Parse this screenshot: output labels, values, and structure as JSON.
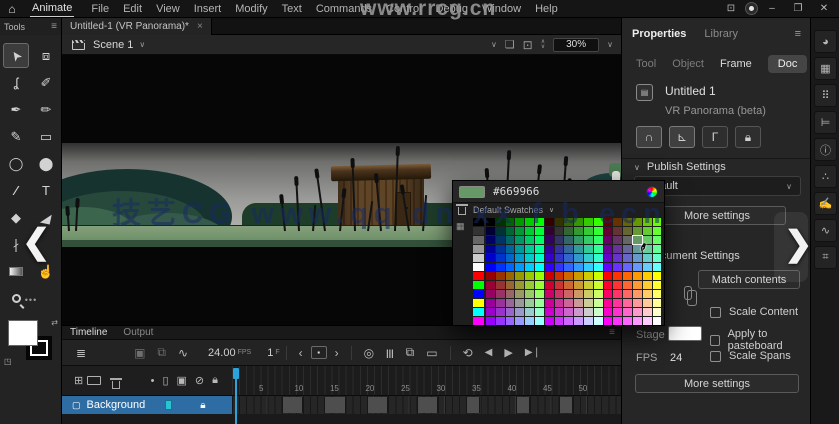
{
  "menubar": {
    "home_icon": "⌂",
    "app_label": "Animate",
    "items": [
      "File",
      "Edit",
      "View",
      "Insert",
      "Modify",
      "Text",
      "Commands",
      "Control",
      "Debug",
      "Window",
      "Help"
    ],
    "watermark": "www.rrcg.cn",
    "workspace_icon": "⊡",
    "minimize_icon": "–",
    "restore_icon": "❐",
    "close_icon": "✕"
  },
  "document_tab": {
    "title": "Untitled-1 (VR Panorama)*",
    "close_icon": "×"
  },
  "tools_panel": {
    "title": "Tools",
    "menu_icon": "≡",
    "more_icon": "•••",
    "tools": [
      {
        "name": "selection-tool",
        "glyph": "➤",
        "selected": true
      },
      {
        "name": "free-transform-tool",
        "glyph": "⧈"
      },
      {
        "name": "lasso-tool",
        "glyph": "ʆ"
      },
      {
        "name": "fluid-brush-tool",
        "glyph": "✐"
      },
      {
        "name": "classic-brush-tool",
        "glyph": "✒"
      },
      {
        "name": "pencil-tool",
        "glyph": "✏"
      },
      {
        "name": "pen-tool",
        "glyph": "✎"
      },
      {
        "name": "rectangle-tool",
        "glyph": "▭"
      },
      {
        "name": "oval-tool",
        "glyph": "◯"
      },
      {
        "name": "primitive-oval-tool",
        "glyph": "⬤"
      },
      {
        "name": "line-tool",
        "glyph": "∕"
      },
      {
        "name": "text-tool",
        "glyph": "T"
      },
      {
        "name": "eraser-tool",
        "glyph": "◆"
      },
      {
        "name": "paint-bucket-tool",
        "glyph": "◢"
      },
      {
        "name": "eyedropper-tool",
        "glyph": "∤"
      },
      {
        "name": "",
        "glyph": ""
      },
      {
        "name": "gradient-swatch-tool",
        "glyph": "",
        "kind": "grad"
      },
      {
        "name": "hand-tool",
        "glyph": "☝"
      },
      {
        "name": "zoom-tool",
        "glyph": "",
        "kind": "mag"
      },
      {
        "name": "",
        "glyph": ""
      }
    ]
  },
  "stage_bar": {
    "scene_label": "Scene 1",
    "scene_chevron": "∨",
    "collapse_chevron": "∨",
    "clip_icon_name": "clip-content-icon",
    "center_icon": "⊡",
    "zoom_value": "30%",
    "zoom_chevron": "∨"
  },
  "canvas": {
    "watermark": "技艺CG   www.qq  dn  xx  f  b  ecn"
  },
  "color_picker": {
    "hex_value": "#669966",
    "selected": "#669966",
    "dropdown_label": "Default Swatches",
    "dropdown_chevron": "∨",
    "grid_icon": "▦",
    "strip": [
      "#000000",
      "#333333",
      "#666666",
      "#999999",
      "#CCCCCC",
      "#FFFFFF",
      "#FF0000",
      "#00FF00",
      "#0000FF",
      "#FFFF00",
      "#00FFFF",
      "#FF00FF"
    ],
    "grid_values": [
      "00",
      "33",
      "66",
      "99",
      "CC",
      "FF"
    ]
  },
  "properties_panel": {
    "tabs": [
      "Properties",
      "Library"
    ],
    "menu_icon": "≡",
    "subtabs": [
      "Tool",
      "Object",
      "Frame",
      "Doc"
    ],
    "active_subtab": "Doc",
    "doc_icon_glyph": "▤",
    "doc_name": "Untitled 1",
    "doc_type": "VR Panorama (beta)",
    "snap_buttons": [
      {
        "name": "snap-to-objects-button",
        "glyph": "∩",
        "active": true
      },
      {
        "name": "snap-align-button",
        "glyph": "⊾",
        "active": true
      },
      {
        "name": "snap-to-guides-button",
        "glyph": "Γ",
        "active": false
      },
      {
        "name": "lock-snap-button",
        "glyph": "",
        "active": false
      }
    ],
    "publish": {
      "title": "Publish Settings",
      "chevron": "∨",
      "profile_value": "Default",
      "more_label": "More settings"
    },
    "document": {
      "title": "Document Settings",
      "chevron": "∨",
      "match_label": "Match contents",
      "checkboxes": [
        "Scale Content",
        "Apply to pasteboard",
        "Scale Spans"
      ],
      "stage_label": "Stage",
      "fps_label": "FPS",
      "fps_value": "24",
      "more_label": "More settings"
    }
  },
  "dock": {
    "icons": [
      {
        "name": "color-panel-icon",
        "glyph": "◕"
      },
      {
        "name": "swatches-panel-icon",
        "glyph": "▦"
      },
      {
        "name": "cc-libraries-panel-icon",
        "glyph": "⠿"
      },
      {
        "name": "align-panel-icon",
        "glyph": "⊨"
      },
      {
        "name": "info-panel-icon",
        "glyph": "ⓘ"
      },
      {
        "name": "assets-panel-icon",
        "glyph": "∴"
      },
      {
        "name": "brush-library-panel-icon",
        "glyph": "✍"
      },
      {
        "name": "history-panel-icon",
        "glyph": "∿"
      },
      {
        "name": "actions-panel-icon",
        "glyph": "⌗"
      }
    ]
  },
  "timeline": {
    "tabs": [
      "Timeline",
      "Output"
    ],
    "menu_icon": "≡",
    "icons": {
      "layers": "≣",
      "camera": "▣",
      "link": "⧉",
      "graph": "∿",
      "prev": "‹",
      "key": "▪",
      "next": "›",
      "onion": "◎",
      "onion_outline": "|||",
      "multi": "⧉",
      "label": "▭",
      "loop": "⟲",
      "back": "◀",
      "play": "▶",
      "fwd": "▶❘",
      "add_layer": "⊞",
      "dot": "•",
      "outline": "▯",
      "cam": "▣",
      "eye": "⊘"
    },
    "fps_value": "24.00",
    "fps_unit": "FPS",
    "frame_value": "1",
    "frame_unit": "F",
    "ruler_labels": [
      5,
      10,
      15,
      20,
      25,
      30,
      35,
      40,
      45,
      50
    ],
    "layer_name": "Background"
  },
  "overlays": {
    "left_chevron": "❮",
    "right_chevron": "❯"
  }
}
